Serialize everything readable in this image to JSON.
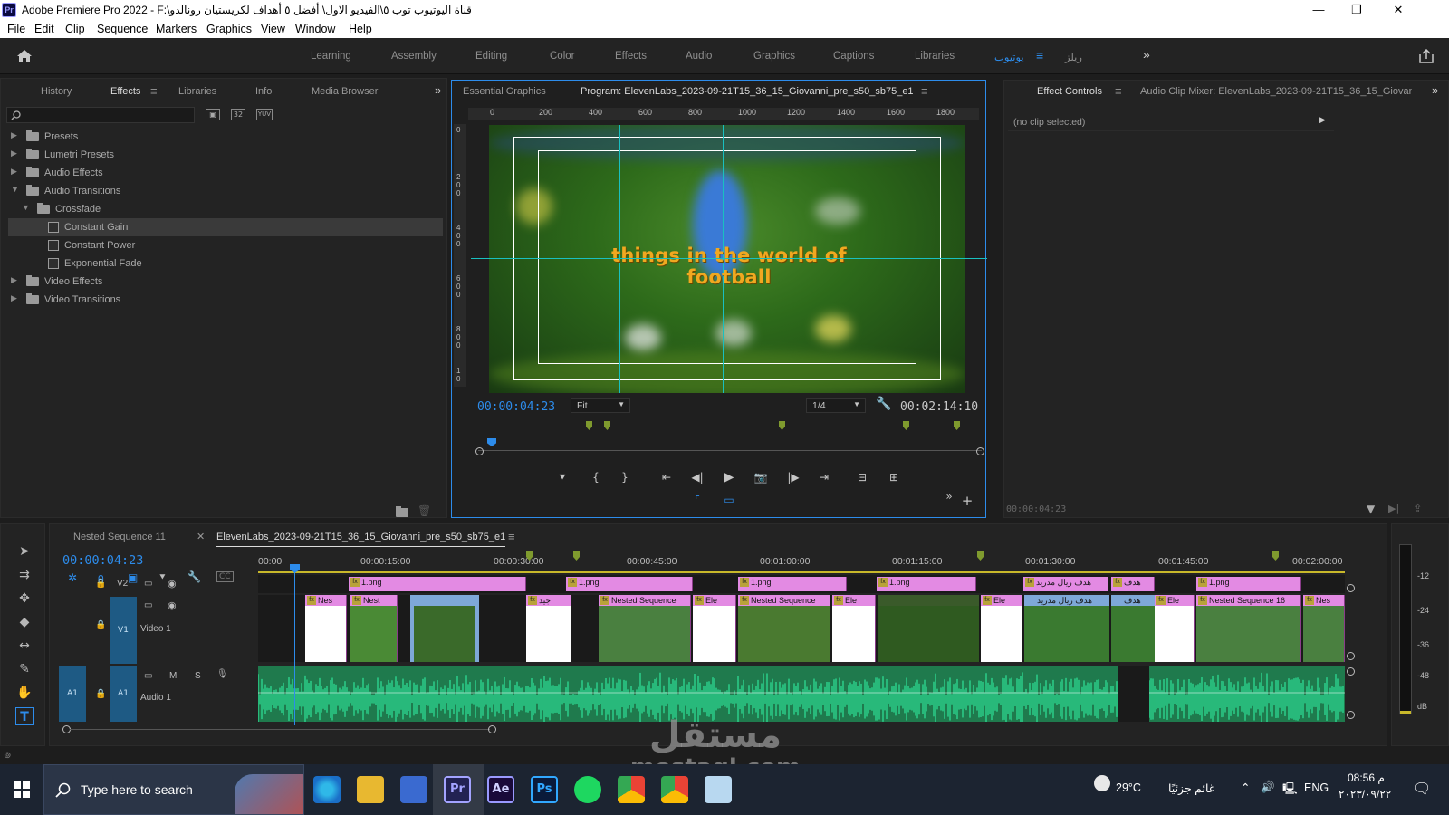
{
  "window": {
    "app_title": "Adobe Premiere Pro 2022 - F:\\قناة اليوتيوب توب ٥\\الفيديو الاول\\ أفضل ٥ أهداف لكريستيان رونالدو",
    "app_icon_label": "Pr",
    "minimize": "—",
    "maximize": "❐",
    "close": "✕"
  },
  "menu": [
    "File",
    "Edit",
    "Clip",
    "Sequence",
    "Markers",
    "Graphics",
    "View",
    "Window",
    "Help"
  ],
  "workspaces": {
    "items": [
      "Learning",
      "Assembly",
      "Editing",
      "Color",
      "Effects",
      "Audio",
      "Graphics",
      "Captions",
      "Libraries"
    ],
    "active": "يوتيوب",
    "extra": "ريلز",
    "more": "»"
  },
  "left_panel": {
    "tabs": [
      "History",
      "Effects",
      "Libraries",
      "Info",
      "Media Browser"
    ],
    "active_tab": "Effects",
    "search_icon": "search-icon",
    "filter_badges": [
      "▣",
      "32",
      "YUV"
    ],
    "tree": [
      {
        "label": "Presets",
        "indent": 0,
        "type": "folder",
        "expanded": false
      },
      {
        "label": "Lumetri Presets",
        "indent": 0,
        "type": "folder",
        "expanded": false
      },
      {
        "label": "Audio Effects",
        "indent": 0,
        "type": "folder",
        "expanded": false
      },
      {
        "label": "Audio Transitions",
        "indent": 0,
        "type": "folder",
        "expanded": true
      },
      {
        "label": "Crossfade",
        "indent": 1,
        "type": "folder",
        "expanded": true
      },
      {
        "label": "Constant Gain",
        "indent": 2,
        "type": "effect",
        "selected": true
      },
      {
        "label": "Constant Power",
        "indent": 2,
        "type": "effect"
      },
      {
        "label": "Exponential Fade",
        "indent": 2,
        "type": "effect"
      },
      {
        "label": "Video Effects",
        "indent": 0,
        "type": "folder",
        "expanded": false
      },
      {
        "label": "Video Transitions",
        "indent": 0,
        "type": "folder",
        "expanded": false
      }
    ]
  },
  "program_monitor": {
    "tab_essential": "Essential Graphics",
    "tab_program": "Program: ElevenLabs_2023-09-21T15_36_15_Giovanni_pre_s50_sb75_e1",
    "ruler_labels": [
      "0",
      "200",
      "400",
      "600",
      "800",
      "1000",
      "1200",
      "1400",
      "1600",
      "1800"
    ],
    "vruler_labels": [
      "0",
      "2 0 0",
      "4 0 0",
      "6 0 0",
      "8 0 0",
      "1 0"
    ],
    "overlay_text": "things in the world of football",
    "current_time": "00:00:04:23",
    "zoom": "Fit",
    "resolution": "1/4",
    "duration": "00:02:14:10",
    "playhead_fraction": 0.027,
    "controls": [
      "marker-icon",
      "mark-in-icon",
      "mark-out-icon",
      "go-to-in-icon",
      "step-back-icon",
      "play-icon",
      "export-frame-icon",
      "step-forward-icon",
      "go-to-out-icon",
      "insert-icon",
      "overwrite-icon"
    ]
  },
  "effect_controls": {
    "tab_effect_controls": "Effect Controls",
    "tab_audio_mixer": "Audio Clip Mixer: ElevenLabs_2023-09-21T15_36_15_Giovan",
    "no_clip": "(no clip selected)",
    "timecode": "00:00:04:23"
  },
  "timeline": {
    "tab_nested": "Nested Sequence 11",
    "tab_active": "ElevenLabs_2023-09-21T15_36_15_Giovanni_pre_s50_sb75_e1",
    "timecode": "00:00:04:23",
    "time_labels": [
      "00:00",
      "00:00:15:00",
      "00:00:30:00",
      "00:00:45:00",
      "00:01:00:00",
      "00:01:15:00",
      "00:01:30:00",
      "00:01:45:00",
      "00:02:00:00"
    ],
    "tracks": {
      "v2": "V2",
      "v1": "V1",
      "v1_name": "Video 1",
      "a1": "A1",
      "a1_name": "Audio 1",
      "m": "M",
      "s": "S"
    },
    "v2_clips": [
      "1.png",
      "1.png",
      "1.png",
      "1.png",
      "هدف ريال مدريد",
      "هدف",
      "1.png"
    ],
    "v1_clips": [
      "Nes",
      "Nest",
      "جيد",
      "Nested Sequence",
      "Ele",
      "Nested Sequence",
      "Ele",
      "Ele",
      "هدف ريال مدريد",
      "هدف",
      "Ele",
      "Nested Sequence 16",
      "Nes"
    ],
    "meter_labels": [
      "-12",
      "-24",
      "-36",
      "-48",
      "dB"
    ]
  },
  "taskbar": {
    "search_placeholder": "Type here to search",
    "weather_temp": "29°C",
    "weather_text": "غائم جزئيًا",
    "language": "ENG",
    "time": "08:56 م",
    "date": "٢٠٢٣/٠٩/٢٢"
  },
  "watermark": {
    "arabic": "مستقل",
    "latin": "mostaql.com"
  },
  "colors": {
    "accent": "#2d8ceb",
    "clip_pink": "#e38ae3",
    "audio_green": "#1f7a4d",
    "waveform": "#2ee39a"
  }
}
